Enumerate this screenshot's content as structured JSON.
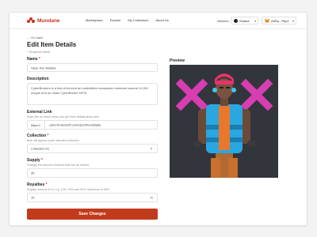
{
  "header": {
    "brand": "Mundane",
    "nav": [
      "Marketplace",
      "Explore",
      "My Collections",
      "About Us"
    ],
    "network_label": "Network",
    "network_value": "Solana",
    "wallet_value": "cNRp...Pbp1"
  },
  "page": {
    "back_label": "Go back",
    "title": "Edit Item Details",
    "required_note": "* Required fields"
  },
  "form": {
    "name": {
      "label": "Name",
      "value": "Viper, the mistake"
    },
    "description": {
      "label": "Description",
      "value": "CyberBrokers is a first-of-its-kind art collectibles ecosystem centered around 10,001 unique and on-chain CyberBroker NFTs."
    },
    "external_link": {
      "label": "External Link",
      "hint": "Enter link on which users can get more details about item",
      "prefix": "https://",
      "value": "cyberbrokersnft.com/viperthemistake"
    },
    "collection": {
      "label": "Collection",
      "hint": "Item will appear under selected collection",
      "value": "Collection 01"
    },
    "supply": {
      "label": "Supply",
      "hint": "Change the amount of tokens that can be minted",
      "value": "45"
    },
    "royalties": {
      "label": "Royalties",
      "hint": "Royalty must be in %, e.g. 10%, 20% and 30%. Maximum of 50%",
      "value": "10",
      "unit": "%"
    },
    "save_label": "Save Changes"
  },
  "preview": {
    "label": "Preview"
  },
  "colors": {
    "accent": "#c23a1c",
    "brand": "#c8321d",
    "preview_bg": "#33353d",
    "cross": "#e040b8"
  }
}
